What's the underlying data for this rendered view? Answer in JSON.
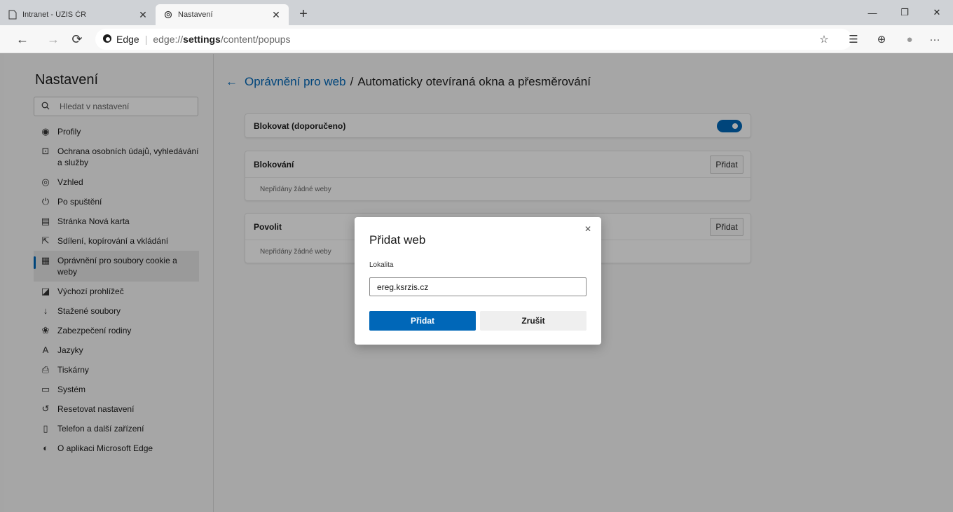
{
  "tabs": [
    {
      "title": "Intranet - ÚZIS ČR",
      "icon": "page-icon",
      "close": "✕"
    },
    {
      "title": "Nastavení",
      "icon": "gear-icon",
      "close": "✕"
    }
  ],
  "new_tab_glyph": "+",
  "window": {
    "minimize": "—",
    "restore": "❐",
    "close": "✕"
  },
  "nav": {
    "back": "←",
    "forward": "→",
    "refresh": "⟳"
  },
  "address": {
    "brand": "Edge",
    "url_prefix": "edge://",
    "url_host": "settings",
    "url_path": "/content/popups"
  },
  "toolbar_icons": {
    "favorite": "☆",
    "favorites": "☰",
    "collections": "⊕",
    "profile": "●",
    "more": "···"
  },
  "sidebar": {
    "title": "Nastavení",
    "search_placeholder": "Hledat v nastavení",
    "items": [
      {
        "label": "Profily",
        "icon": "profile-icon",
        "glyph": "◉"
      },
      {
        "label": "Ochrana osobních údajů, vyhledávání a služby",
        "icon": "lock-icon",
        "glyph": "⊡"
      },
      {
        "label": "Vzhled",
        "icon": "appearance-icon",
        "glyph": "◎"
      },
      {
        "label": "Po spuštění",
        "icon": "power-icon",
        "glyph": "⏻"
      },
      {
        "label": "Stránka Nová karta",
        "icon": "newtab-icon",
        "glyph": "▤"
      },
      {
        "label": "Sdílení, kopírování a vkládání",
        "icon": "share-icon",
        "glyph": "⇱"
      },
      {
        "label": "Oprávnění pro soubory cookie a weby",
        "icon": "cookie-icon",
        "glyph": "▦",
        "active": true
      },
      {
        "label": "Výchozí prohlížeč",
        "icon": "browser-icon",
        "glyph": "◪"
      },
      {
        "label": "Stažené soubory",
        "icon": "download-icon",
        "glyph": "↓"
      },
      {
        "label": "Zabezpečení rodiny",
        "icon": "family-icon",
        "glyph": "❀"
      },
      {
        "label": "Jazyky",
        "icon": "language-icon",
        "glyph": "A"
      },
      {
        "label": "Tiskárny",
        "icon": "printer-icon",
        "glyph": "⎙"
      },
      {
        "label": "Systém",
        "icon": "system-icon",
        "glyph": "▭"
      },
      {
        "label": "Resetovat nastavení",
        "icon": "reset-icon",
        "glyph": "↺"
      },
      {
        "label": "Telefon a další zařízení",
        "icon": "phone-icon",
        "glyph": "▯"
      },
      {
        "label": "O aplikaci Microsoft Edge",
        "icon": "edge-icon",
        "glyph": "◐"
      }
    ]
  },
  "main": {
    "back_glyph": "←",
    "breadcrumb_link": "Oprávnění pro web",
    "breadcrumb_sep": "/",
    "breadcrumb_current": "Automaticky otevíraná okna a přesměrování",
    "block_toggle_label": "Blokovat (doporučeno)",
    "block_toggle_on": true,
    "sections": [
      {
        "title": "Blokování",
        "add_label": "Přidat",
        "empty": "Nepřidány žádné weby"
      },
      {
        "title": "Povolit",
        "add_label": "Přidat",
        "empty": "Nepřidány žádné weby"
      }
    ]
  },
  "dialog": {
    "title": "Přidat web",
    "close_glyph": "✕",
    "field_label": "Lokalita",
    "field_value": "ereg.ksrzis.cz",
    "primary_label": "Přidat",
    "secondary_label": "Zrušit"
  },
  "colors": {
    "accent": "#0067b8",
    "overlay": "rgba(0,0,0,0.33)"
  }
}
